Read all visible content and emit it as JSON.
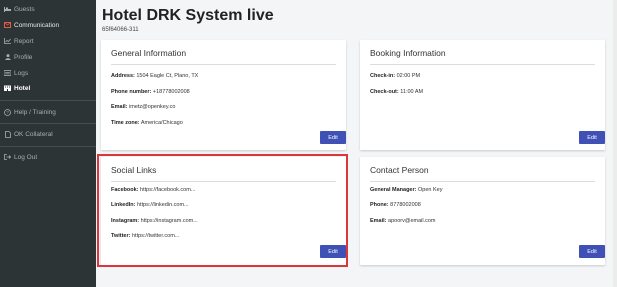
{
  "sidebar": {
    "items": [
      {
        "label": "Guests",
        "icon": "bed-icon"
      },
      {
        "label": "Communication",
        "icon": "mail-icon"
      },
      {
        "label": "Report",
        "icon": "chart-icon"
      },
      {
        "label": "Profile",
        "icon": "person-icon"
      },
      {
        "label": "Logs",
        "icon": "list-icon"
      },
      {
        "label": "Hotel",
        "icon": "hotel-icon"
      },
      {
        "label": "Help / Training",
        "icon": "help-icon"
      },
      {
        "label": "OK Collateral",
        "icon": "document-icon"
      },
      {
        "label": "Log Out",
        "icon": "logout-icon"
      }
    ],
    "active": "Hotel"
  },
  "page": {
    "title": "Hotel DRK System live",
    "subtitle": "65f64066-311"
  },
  "general": {
    "title": "General Information",
    "address_label": "Address:",
    "address": "1504 Eagle Ct, Plano, TX",
    "phone_label": "Phone number:",
    "phone": "+18778002008",
    "email_label": "Email:",
    "email": "imetz@openkey.co",
    "timezone_label": "Time zone:",
    "timezone": "America/Chicago",
    "edit": "Edit"
  },
  "booking": {
    "title": "Booking Information",
    "checkin_label": "Check-in:",
    "checkin": "02:00 PM",
    "checkout_label": "Check-out:",
    "checkout": "11:00 AM",
    "edit": "Edit"
  },
  "social": {
    "title": "Social Links",
    "facebook_label": "Facebook:",
    "facebook": "https://facebook.com...",
    "linkedin_label": "LinkedIn:",
    "linkedin": "https://linkedin.com...",
    "instagram_label": "Instagram:",
    "instagram": "https://instagram.com...",
    "twitter_label": "Twitter:",
    "twitter": "https://twitter.com...",
    "edit": "Edit"
  },
  "contact": {
    "title": "Contact Person",
    "gm_label": "General Manager:",
    "gm": "Open Key",
    "phone_label": "Phone:",
    "phone": "8778002008",
    "email_label": "Email:",
    "email": "apoorv@email.com",
    "edit": "Edit"
  },
  "colors": {
    "accent": "#3f51b5",
    "highlight": "#d9363e",
    "sidebar": "#2d3436",
    "communication_icon": "#e05b4a"
  }
}
